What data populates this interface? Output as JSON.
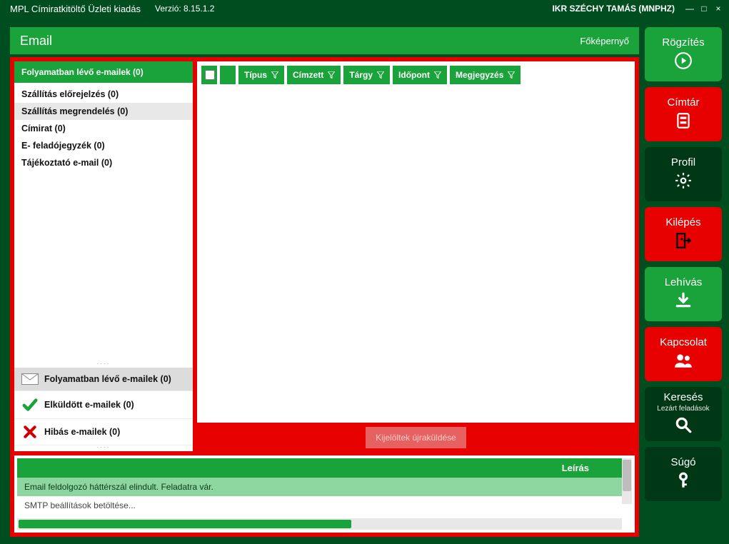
{
  "app": {
    "title": "MPL Címiratkitöltő Üzleti kiadás",
    "version_label": "Verzió: 8.15.1.2",
    "user": "IKR SZÉCHY TAMÁS  (MNPHZ)"
  },
  "page": {
    "title": "Email",
    "breadcrumb": "Főképernyő"
  },
  "tree": {
    "header": "Folyamatban lévő e-mailek (0)",
    "items": [
      "Szállítás előrejelzés (0)",
      "Szállítás megrendelés (0)",
      "Címirat (0)",
      "E- feladójegyzék (0)",
      "Tájékoztató e-mail (0)"
    ],
    "selected_index": 1
  },
  "folders": {
    "in_progress": "Folyamatban lévő e-mailek (0)",
    "sent": "Elküldött e-mailek (0)",
    "error": "Hibás e-mailek (0)"
  },
  "grid": {
    "columns": [
      "Típus",
      "Címzett",
      "Tárgy",
      "Időpont",
      "Megjegyzés"
    ]
  },
  "resend_btn": "Kijelöltek újraküldése",
  "log": {
    "header": "Leírás",
    "row1": "Email feldolgozó háttérszál elindult. Feladatra vár.",
    "row2": "SMTP beállítások betöltése..."
  },
  "actions": {
    "rogzites": "Rögzítés",
    "cimtar": "Címtár",
    "profil": "Profil",
    "kilepes": "Kilépés",
    "lehivas": "Lehívás",
    "kapcsolat": "Kapcsolat",
    "kereses": "Keresés",
    "kereses_sub": "Lezárt feladások",
    "sugo": "Súgó"
  }
}
